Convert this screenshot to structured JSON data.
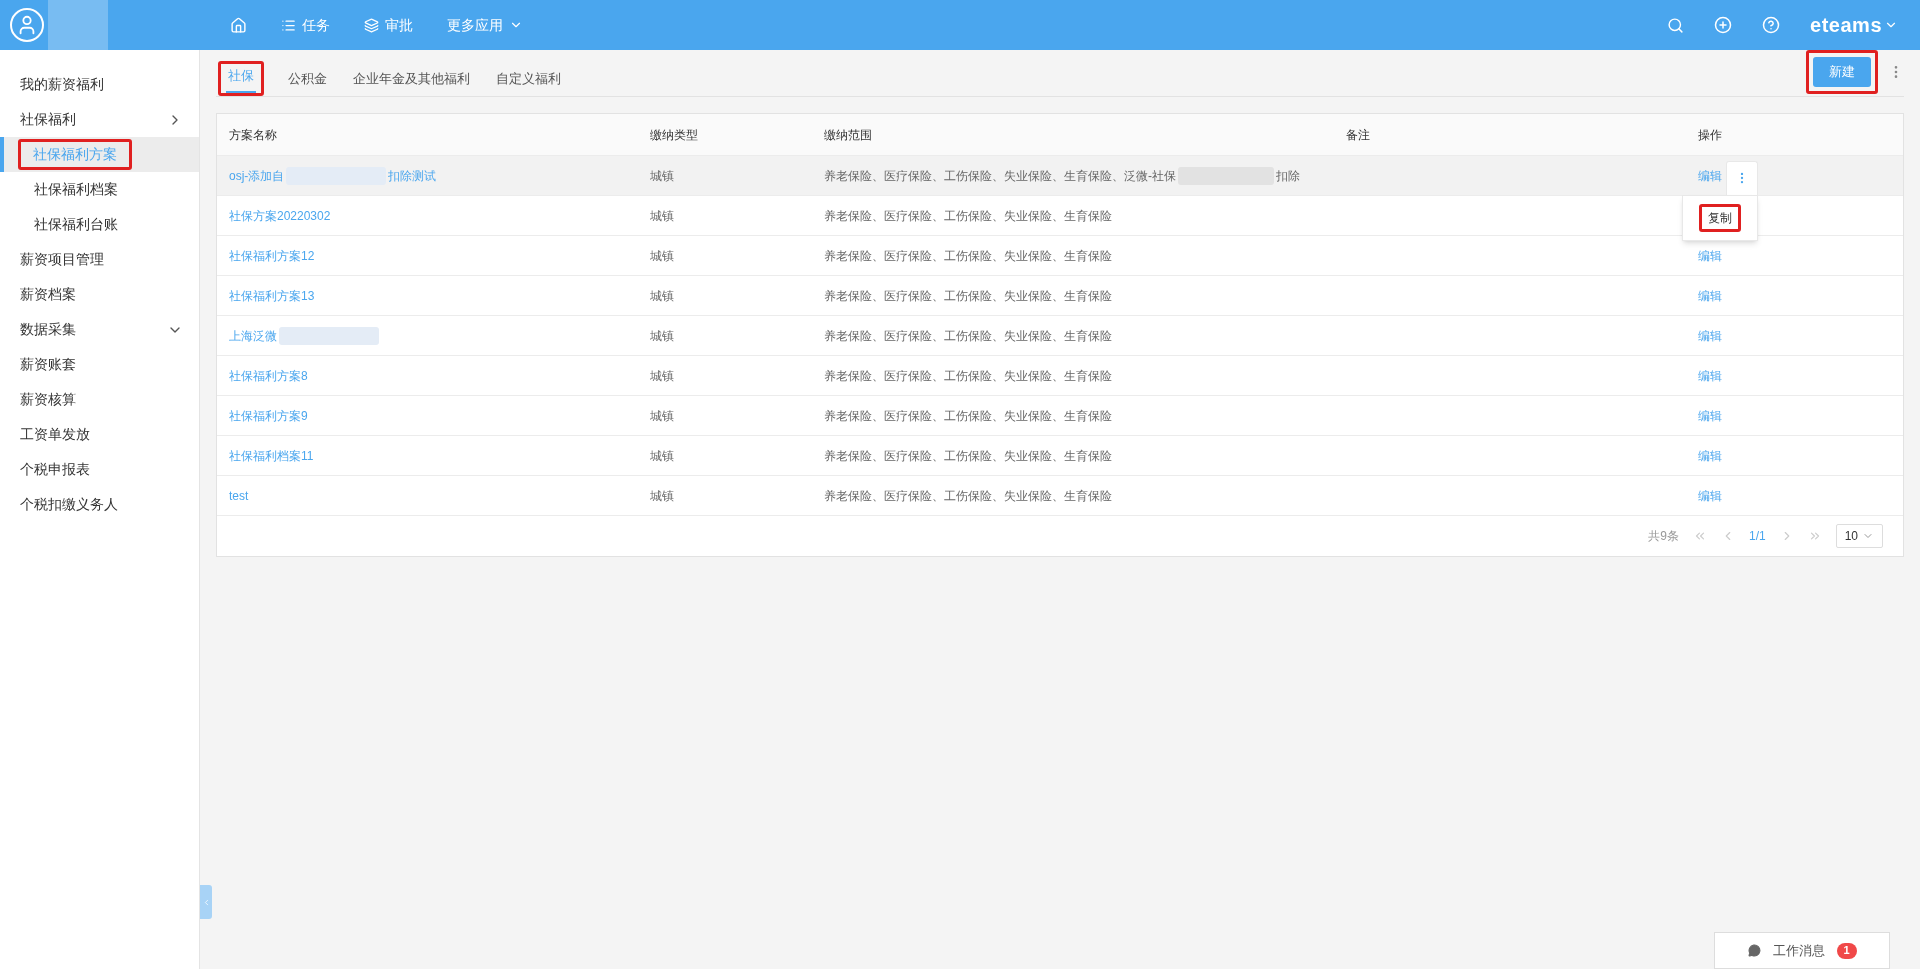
{
  "topbar": {
    "nav": [
      {
        "kind": "home"
      },
      {
        "kind": "list",
        "label": "任务"
      },
      {
        "kind": "layers",
        "label": "审批"
      },
      {
        "kind": "more",
        "label": "更多应用"
      }
    ],
    "brand": "eteams"
  },
  "sidebar": {
    "items": [
      {
        "label": "我的薪资福利",
        "selected": false
      },
      {
        "label": "社保福利",
        "selected": false,
        "expanded": true,
        "children": [
          {
            "label": "社保福利方案",
            "selected": true,
            "annotated": true
          },
          {
            "label": "社保福利档案",
            "selected": false
          },
          {
            "label": "社保福利台账",
            "selected": false
          }
        ]
      },
      {
        "label": "薪资项目管理",
        "selected": false
      },
      {
        "label": "薪资档案",
        "selected": false
      },
      {
        "label": "数据采集",
        "selected": false,
        "expanded": false
      },
      {
        "label": "薪资账套",
        "selected": false
      },
      {
        "label": "薪资核算",
        "selected": false
      },
      {
        "label": "工资单发放",
        "selected": false
      },
      {
        "label": "个税申报表",
        "selected": false
      },
      {
        "label": "个税扣缴义务人",
        "selected": false
      }
    ]
  },
  "tabs": [
    {
      "label": "社保",
      "selected": true,
      "annotated": true
    },
    {
      "label": "公积金",
      "selected": false
    },
    {
      "label": "企业年金及其他福利",
      "selected": false
    },
    {
      "label": "自定义福利",
      "selected": false
    }
  ],
  "new_button": {
    "label": "新建",
    "annotated": true
  },
  "table": {
    "columns": [
      "方案名称",
      "缴纳类型",
      "缴纳范围",
      "备注",
      "操作"
    ],
    "rows": [
      {
        "name": "osj-添加自",
        "name_tail": "扣除测试",
        "blurred": true,
        "type": "城镇",
        "range": "养老保险、医疗保险、工伤保险、失业保险、生育保险、泛微-社保",
        "range_tail": "扣除",
        "action": "编辑",
        "hovered": true,
        "menu": {
          "items": [
            {
              "label": "复制",
              "annotated": true
            }
          ]
        }
      },
      {
        "name": "社保方案20220302",
        "type": "城镇",
        "range": "养老保险、医疗保险、工伤保险、失业保险、生育保险"
      },
      {
        "name": "社保福利方案12",
        "type": "城镇",
        "range": "养老保险、医疗保险、工伤保险、失业保险、生育保险",
        "action": "编辑"
      },
      {
        "name": "社保福利方案13",
        "type": "城镇",
        "range": "养老保险、医疗保险、工伤保险、失业保险、生育保险",
        "action": "编辑"
      },
      {
        "name": "上海泛微",
        "blurred": true,
        "type": "城镇",
        "range": "养老保险、医疗保险、工伤保险、失业保险、生育保险",
        "action": "编辑"
      },
      {
        "name": "社保福利方案8",
        "type": "城镇",
        "range": "养老保险、医疗保险、工伤保险、失业保险、生育保险",
        "action": "编辑"
      },
      {
        "name": "社保福利方案9",
        "type": "城镇",
        "range": "养老保险、医疗保险、工伤保险、失业保险、生育保险",
        "action": "编辑"
      },
      {
        "name": "社保福利档案11",
        "type": "城镇",
        "range": "养老保险、医疗保险、工伤保险、失业保险、生育保险",
        "action": "编辑"
      },
      {
        "name": "test",
        "type": "城镇",
        "range": "养老保险、医疗保险、工伤保险、失业保险、生育保险",
        "action": "编辑"
      }
    ]
  },
  "pagination": {
    "total": "共9条",
    "page": "1/1",
    "page_size": "10"
  },
  "messages": {
    "label": "工作消息",
    "count": "1"
  }
}
